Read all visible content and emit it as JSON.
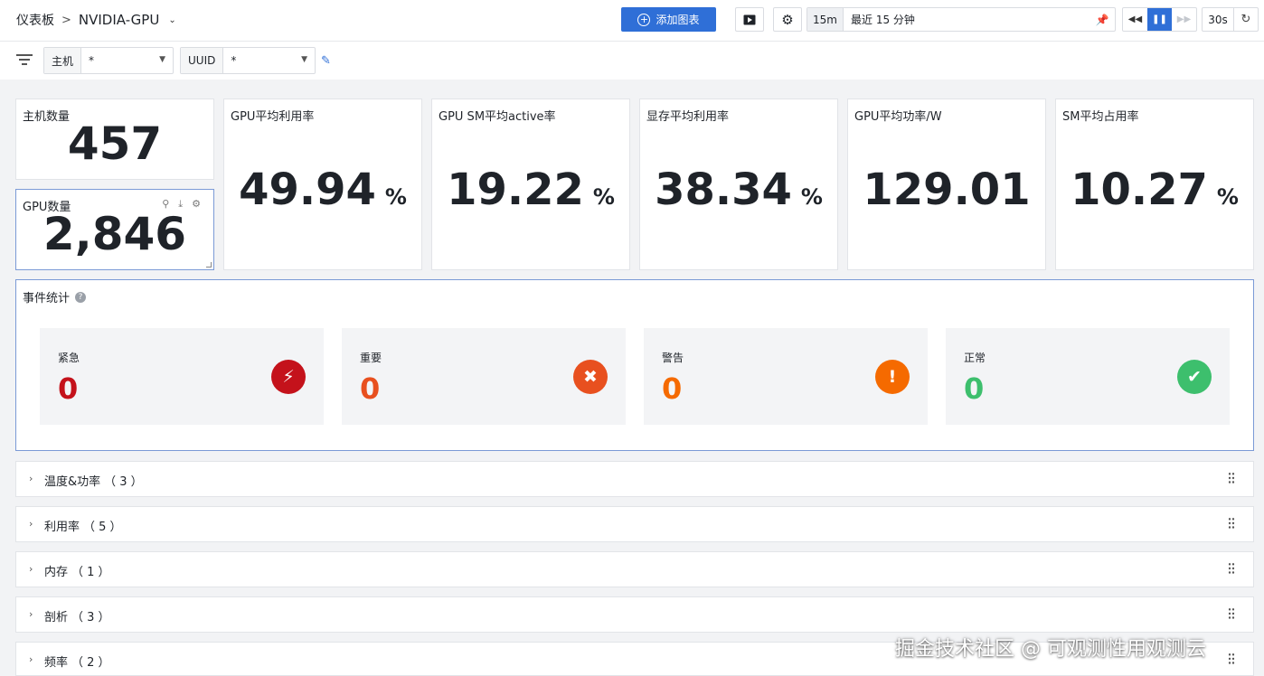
{
  "breadcrumb": {
    "root": "仪表板",
    "separator": ">",
    "dashboard": "NVIDIA-GPU"
  },
  "toolbar": {
    "add_chart_label": "添加图表",
    "time_short": "15m",
    "time_long": "最近 15 分钟",
    "refresh_interval": "30s"
  },
  "filters": [
    {
      "label": "主机",
      "value": "*"
    },
    {
      "label": "UUID",
      "value": "*"
    }
  ],
  "stats": {
    "host_count": {
      "title": "主机数量",
      "value": "457"
    },
    "gpu_count": {
      "title": "GPU数量",
      "value": "2,846"
    },
    "cards": [
      {
        "title": "GPU平均利用率",
        "value": "49.94",
        "unit": "%"
      },
      {
        "title": "GPU SM平均active率",
        "value": "19.22",
        "unit": "%"
      },
      {
        "title": "显存平均利用率",
        "value": "38.34",
        "unit": "%"
      },
      {
        "title": "GPU平均功率/W",
        "value": "129.01",
        "unit": ""
      },
      {
        "title": "SM平均占用率",
        "value": "10.27",
        "unit": "%"
      }
    ]
  },
  "events": {
    "title": "事件统计",
    "items": [
      {
        "label": "紧急",
        "count": "0",
        "color": "#c4121b",
        "icon": "lightning-icon"
      },
      {
        "label": "重要",
        "count": "0",
        "color": "#e8501f",
        "icon": "close-circle-icon"
      },
      {
        "label": "警告",
        "count": "0",
        "color": "#f56a00",
        "icon": "exclamation-icon"
      },
      {
        "label": "正常",
        "count": "0",
        "color": "#3dbf6d",
        "icon": "check-circle-icon"
      }
    ]
  },
  "groups": [
    {
      "label": "温度&功率",
      "count": "（ 3 ）"
    },
    {
      "label": "利用率",
      "count": "（ 5 ）"
    },
    {
      "label": "内存",
      "count": "（ 1 ）"
    },
    {
      "label": "剖析",
      "count": "（ 3 ）"
    },
    {
      "label": "频率",
      "count": "（ 2 ）"
    }
  ],
  "watermark": "掘金技术社区 @ 可观测性用观测云"
}
